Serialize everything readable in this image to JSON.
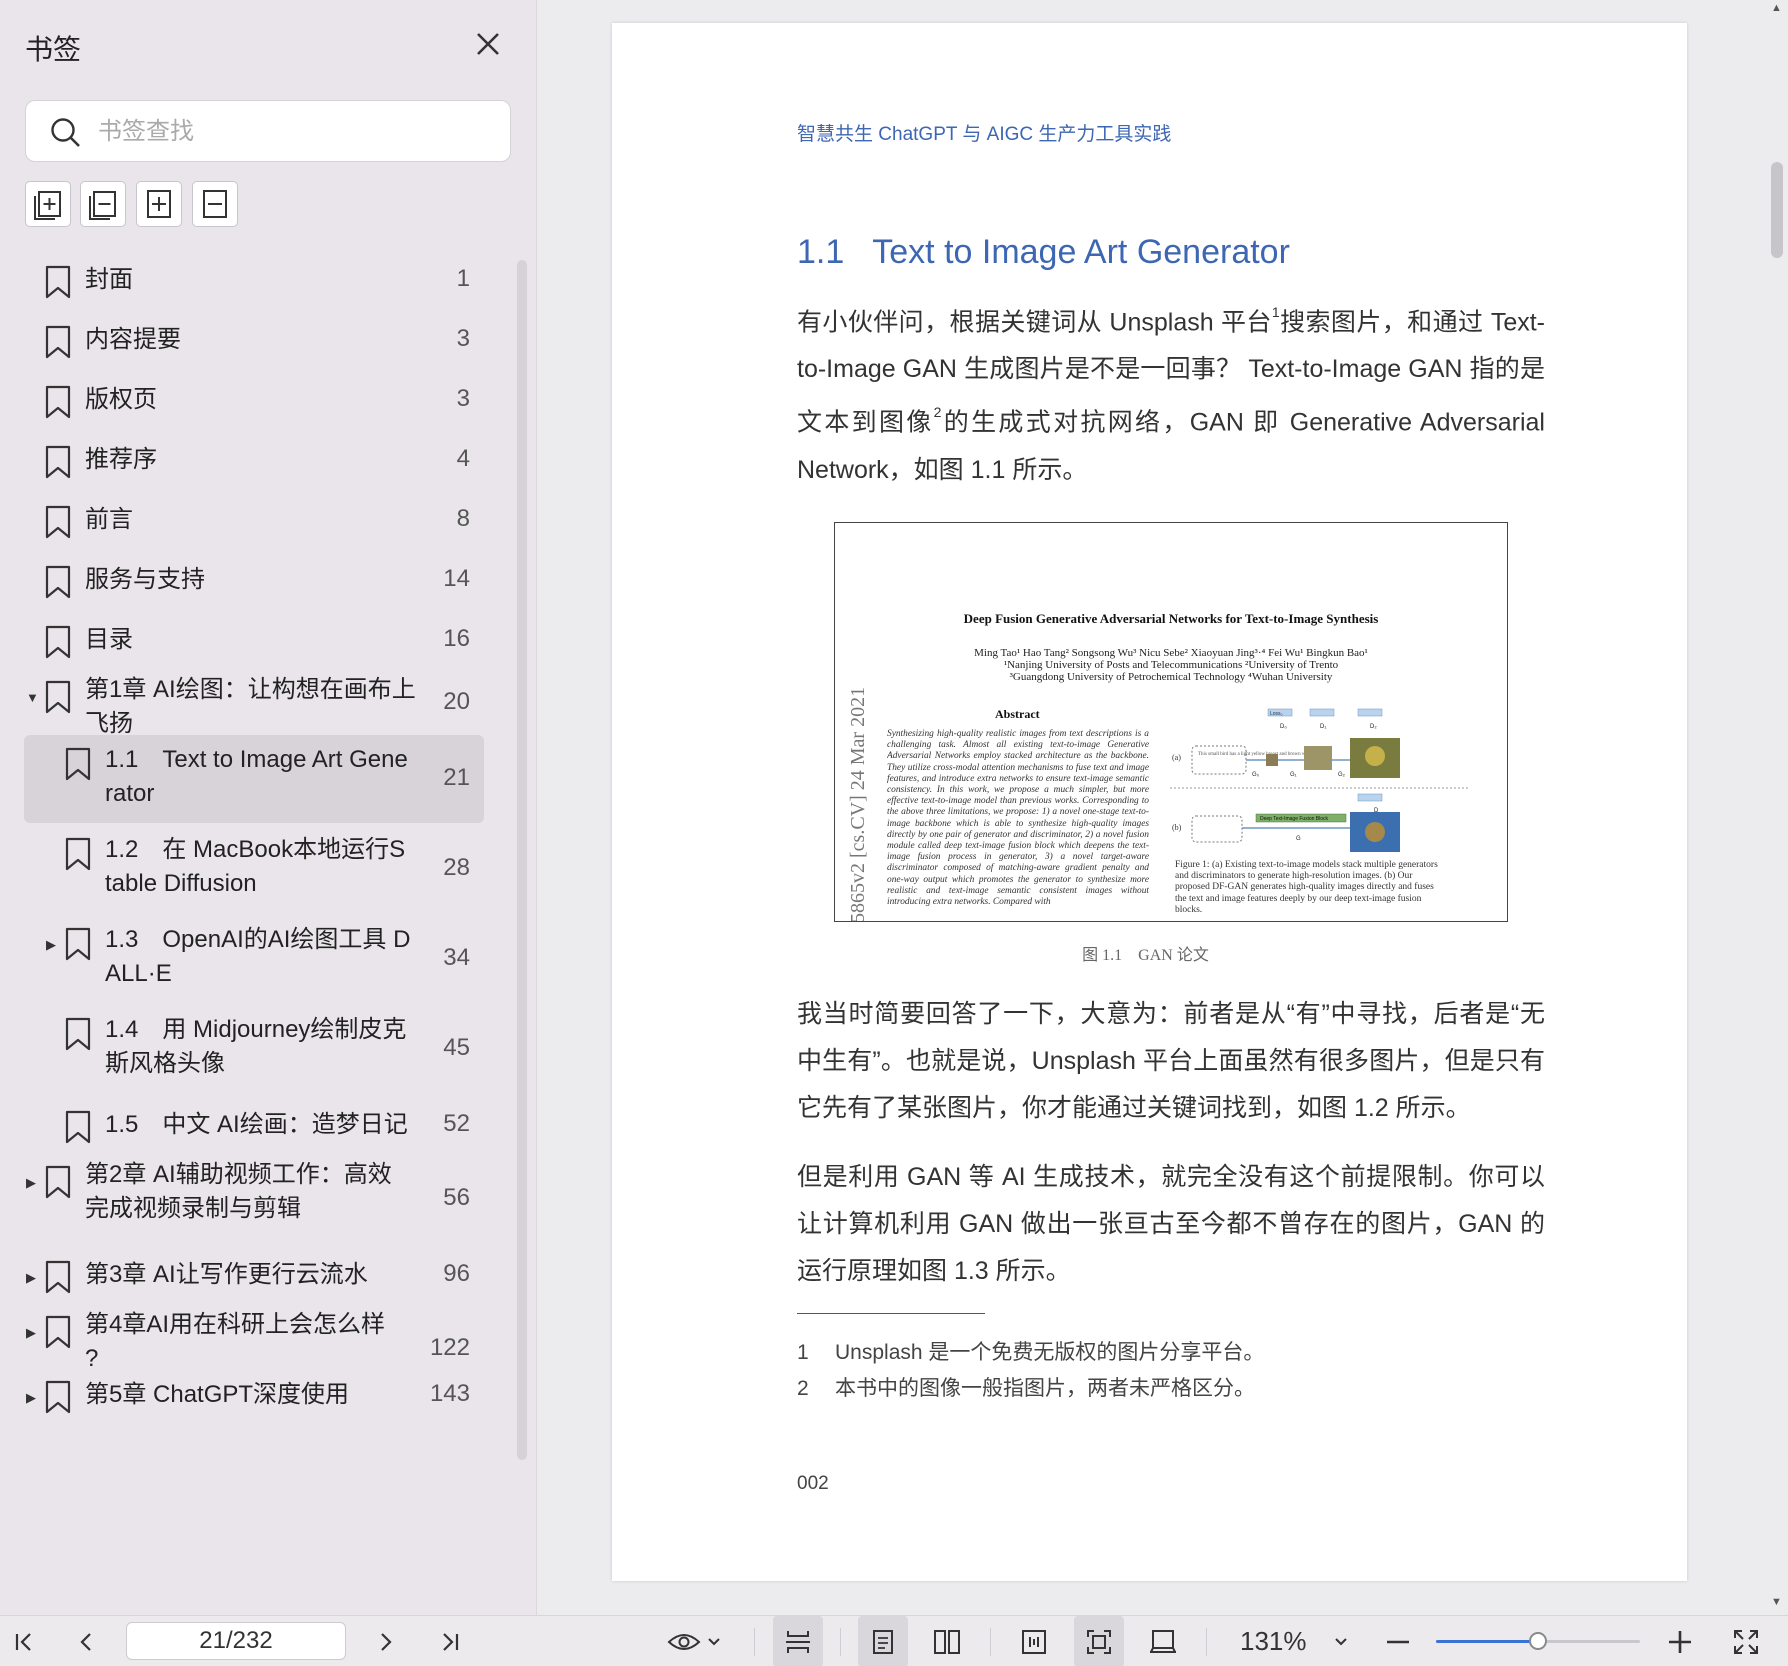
{
  "sidebar": {
    "title": "书签",
    "search_placeholder": "书签查找",
    "tools": [
      "expand-all-icon",
      "collapse-all-icon",
      "add-bookmark-icon",
      "remove-bookmark-icon"
    ],
    "bookmarks": [
      {
        "label": "封面",
        "page": "1",
        "level": 0,
        "expand": "none"
      },
      {
        "label": "内容提要",
        "page": "3",
        "level": 0,
        "expand": "none"
      },
      {
        "label": "版权页",
        "page": "3",
        "level": 0,
        "expand": "none"
      },
      {
        "label": "推荐序",
        "page": "4",
        "level": 0,
        "expand": "none"
      },
      {
        "label": "前言",
        "page": "8",
        "level": 0,
        "expand": "none"
      },
      {
        "label": "服务与支持",
        "page": "14",
        "level": 0,
        "expand": "none"
      },
      {
        "label": "目录",
        "page": "16",
        "level": 0,
        "expand": "none"
      },
      {
        "label1": "第1章 AI绘图：让构想在画布上",
        "label2": "飞扬",
        "page": "20",
        "level": 0,
        "expand": "open"
      },
      {
        "label1": "1.1　Text to Image Art Gene",
        "label2": "rator",
        "page": "21",
        "level": 1,
        "expand": "none",
        "selected": true
      },
      {
        "label1": "1.2　在 MacBook本地运行S",
        "label2": "table Diffusion",
        "page": "28",
        "level": 1,
        "expand": "none"
      },
      {
        "label1": "1.3　OpenAI的AI绘图工具 D",
        "label2": "ALL·E",
        "page": "34",
        "level": 1,
        "expand": "closed"
      },
      {
        "label1": "1.4　用 Midjourney绘制皮克",
        "label2": "斯风格头像",
        "page": "45",
        "level": 1,
        "expand": "none"
      },
      {
        "label": "1.5　中文 AI绘画：造梦日记",
        "page": "52",
        "level": 1,
        "expand": "none"
      },
      {
        "label1": "第2章 AI辅助视频工作：高效",
        "label2": "完成视频录制与剪辑",
        "page": "56",
        "level": 0,
        "expand": "closed"
      },
      {
        "label": "第3章 AI让写作更行云流水",
        "page": "96",
        "level": 0,
        "expand": "closed"
      },
      {
        "label1": "第4章AI用在科研上会怎么样",
        "label2": "?",
        "page": "122",
        "level": 0,
        "expand": "closed"
      },
      {
        "label": "第5章 ChatGPT深度使用",
        "page": "143",
        "level": 0,
        "expand": "closed"
      }
    ]
  },
  "document": {
    "running_head": "智慧共生 ChatGPT 与 AIGC 生产力工具实践",
    "section_number": "1.1",
    "section_title": "Text to Image Art Generator",
    "para1": {
      "a": "有小伙伴问，根据关键词从 Unsplash 平台",
      "sup1": "1",
      "b": "搜索图片，和通过 Text-to-Image GAN 生成图片是不是一回事？ Text-to-Image GAN 指的是文本到图像",
      "sup2": "2",
      "c": "的生成式对抗网络，GAN 即 Generative Adversarial Network，如图 1.1 所示。"
    },
    "figure": {
      "title": "Deep Fusion Generative Adversarial Networks for Text-to-Image Synthesis",
      "authors_line1": "Ming Tao¹  Hao Tang²  Songsong Wu³  Nicu Sebe²  Xiaoyuan Jing³·⁴  Fei Wu¹  Bingkun Bao¹",
      "authors_line2": "¹Nanjing University of Posts and Telecommunications   ²University of Trento",
      "authors_line3": "³Guangdong University of Petrochemical Technology    ⁴Wuhan University",
      "arxiv": "5865v2  [cs.CV]  24 Mar 2021",
      "abstract_heading": "Abstract",
      "abstract_text": "Synthesizing high-quality realistic images from text descriptions is a challenging task. Almost all existing text-to-image Generative Adversarial Networks employ stacked architecture as the backbone. They utilize cross-modal attention mechanisms to fuse text and image features, and introduce extra networks to ensure text-image semantic consistency. In this work, we propose a much simpler, but more effective text-to-image model than previous works. Corresponding to the above three limitations, we propose: 1) a novel one-stage text-to-image backbone which is able to synthesize high-quality images directly by one pair of generator and discriminator, 2) a novel fusion module called deep text-image fusion block which deepens the text-image fusion process in generator, 3) a novel target-aware discriminator composed of matching-aware gradient penalty and one-way output which promotes the generator to synthesize more realistic and text-image semantic consistent images without introducing extra networks. Compared with",
      "caption_text": "Figure 1: (a) Existing text-to-image models stack multiple generators and discriminators to generate high-resolution images. (b) Our proposed DF-GAN generates high-quality images directly and fuses the text and image features deeply by our deep text-image fusion blocks.",
      "diagram_labels": {
        "a": "(a)",
        "b": "(b)",
        "bubble": "This small bird has a light yellow breast and brown wings.",
        "g0": "G₀",
        "g1": "G₁",
        "g2": "G₂",
        "g": "G",
        "d0": "D₀",
        "d1": "D₁",
        "d2": "D₂",
        "d": "D",
        "loss": "Loss₀",
        "fusion": "Deep Text-Image Fusion Block"
      },
      "label": "图 1.1　GAN 论文"
    },
    "para2": "我当时简要回答了一下，大意为：前者是从“有”中寻找，后者是“无中生有”。也就是说，Unsplash 平台上面虽然有很多图片，但是只有它先有了某张图片，你才能通过关键词找到，如图 1.2 所示。",
    "para3": "但是利用 GAN 等 AI 生成技术，就完全没有这个前提限制。你可以让计算机利用 GAN 做出一张亘古至今都不曾存在的图片，GAN 的运行原理如图 1.3 所示。",
    "footnotes": [
      {
        "n": "1",
        "text": "Unsplash 是一个免费无版权的图片分享平台。"
      },
      {
        "n": "2",
        "text": "本书中的图像一般指图片，两者未严格区分。"
      }
    ],
    "page_number": "002"
  },
  "toolbar": {
    "page_indicator": "21/232",
    "zoom": "131%",
    "zoom_fraction": 0.5,
    "icons": [
      "first-page-icon",
      "prev-page-icon",
      "next-page-icon",
      "last-page-icon",
      "eye-icon",
      "continuous-scroll-icon",
      "single-page-icon",
      "two-page-icon",
      "fit-width-icon",
      "fit-page-icon",
      "rotate-icon",
      "zoom-out-icon",
      "zoom-in-icon",
      "fullscreen-icon"
    ]
  },
  "colors": {
    "accent": "#3d66b3",
    "slider": "#3a73d6",
    "sidebar_bg": "#e9e5ea",
    "selected_row": "#d7d3d8"
  }
}
